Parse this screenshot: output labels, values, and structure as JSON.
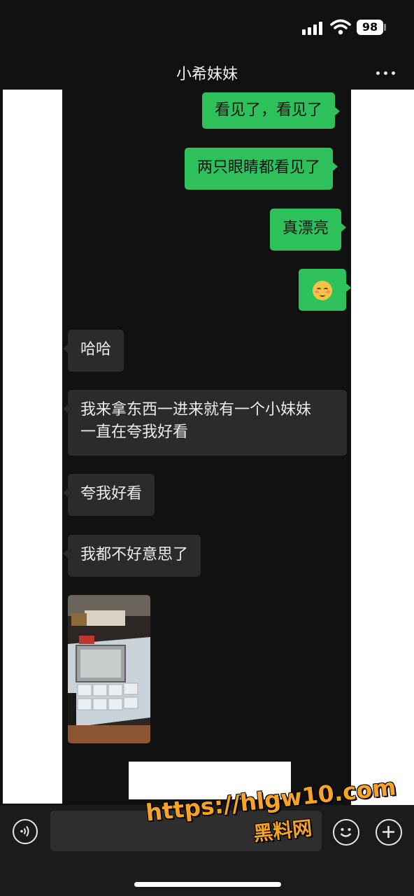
{
  "status_bar": {
    "battery": "98"
  },
  "header": {
    "title": "小希妹妹"
  },
  "messages": [
    {
      "side": "sent",
      "text": "看见了，看见了"
    },
    {
      "side": "sent",
      "text": "两只眼睛都看见了"
    },
    {
      "side": "sent",
      "text": "真漂亮"
    },
    {
      "side": "sent",
      "emoji": "smiling-face-emoji"
    },
    {
      "side": "received",
      "text": "哈哈"
    },
    {
      "side": "received",
      "lines": [
        "我来拿东西一进来就有一个小妹妹",
        "一直在夸我好看"
      ]
    },
    {
      "side": "received",
      "text": "夸我好看"
    },
    {
      "side": "received",
      "text": "我都不好意思了"
    },
    {
      "side": "received",
      "image": "shop-counter-photo"
    }
  ],
  "watermark": {
    "url": "https://hlgw10.com",
    "name": "黑料网"
  },
  "colors": {
    "sent_bubble": "#2ec05a",
    "received_bubble": "#2b2b2b",
    "background": "#111111",
    "watermark": "#f7a325"
  },
  "icons": {
    "voice": "voice-mode-icon",
    "emoji": "emoji-icon",
    "plus": "plus-icon",
    "more": "more-icon"
  }
}
